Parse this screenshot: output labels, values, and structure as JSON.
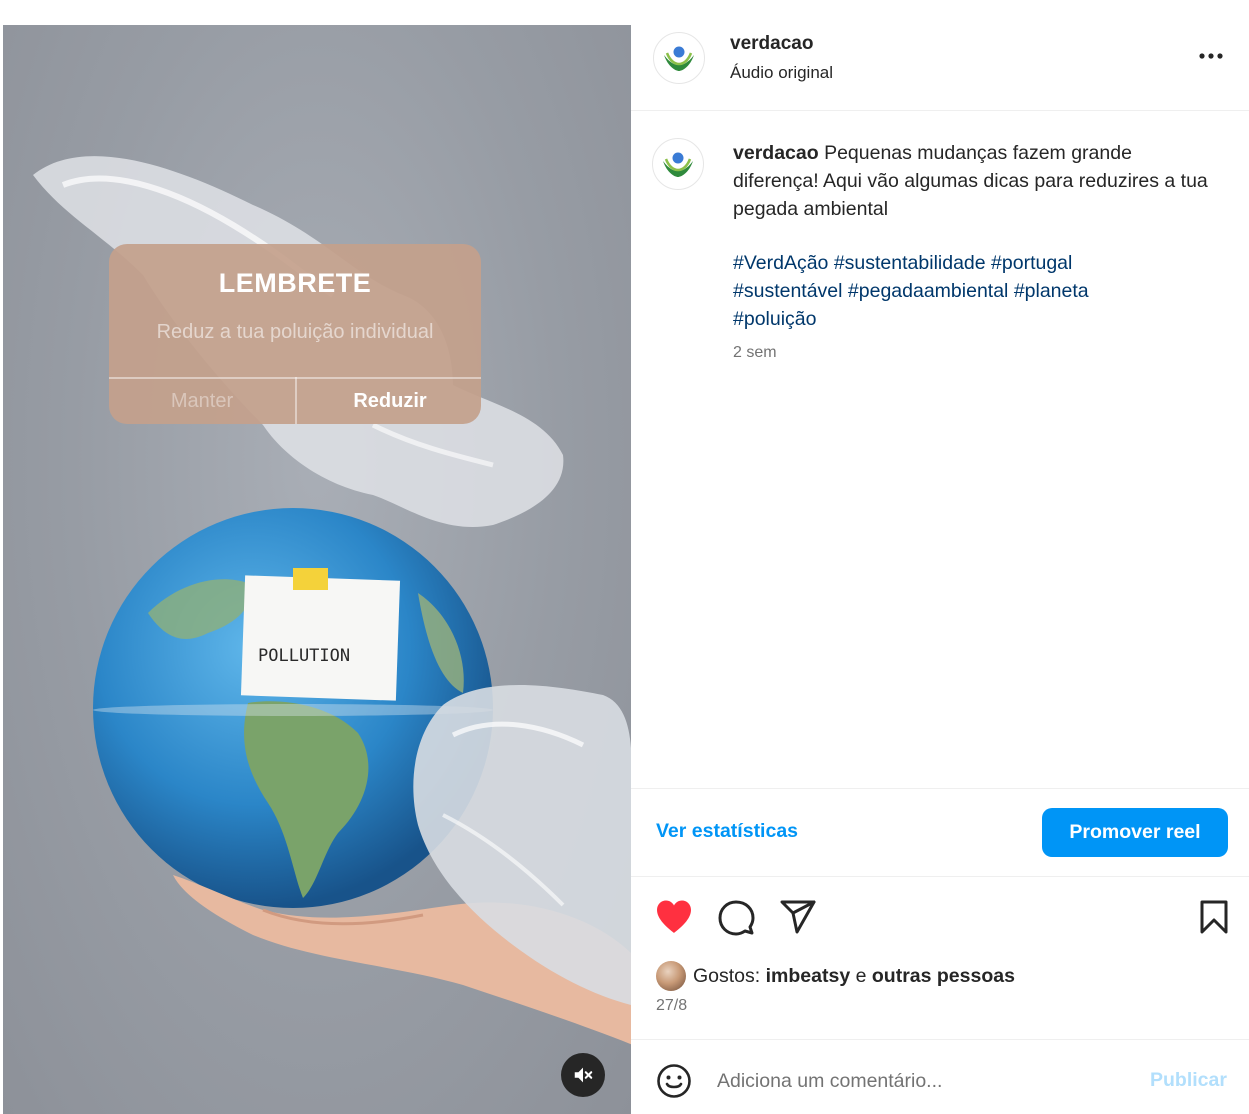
{
  "post": {
    "username": "verdacao",
    "audio": "Áudio original",
    "caption_text": "Pequenas mudanças fazem grande diferença! Aqui vão algumas dicas para reduzires a tua pegada ambiental",
    "hashtags": [
      "#VerdAção",
      "#sustentabilidade",
      "#portugal",
      "#sustentável",
      "#pegadaambiental",
      "#planeta",
      "#poluição"
    ],
    "time_ago": "2 sem"
  },
  "media": {
    "reminder_title": "LEMBRETE",
    "reminder_text": "Reduz a tua poluição individual",
    "keep_label": "Manter",
    "reduce_label": "Reduzir",
    "sticky_note": "POLLUTION",
    "mute_icon": "speaker-muted-icon"
  },
  "actions": {
    "stats_label": "Ver estatísticas",
    "promote_label": "Promover reel",
    "icons": [
      "heart-filled-icon",
      "comment-icon",
      "share-icon",
      "bookmark-icon"
    ],
    "liked": true
  },
  "likes": {
    "prefix": "Gostos:",
    "user": "imbeatsy",
    "connector": "e",
    "others": "outras pessoas"
  },
  "date": "27/8",
  "comment": {
    "placeholder": "Adiciona um comentário...",
    "value": "",
    "publish_label": "Publicar"
  },
  "colors": {
    "accent": "#0095f6",
    "like": "#ff3040",
    "hashtag": "#00376b",
    "muted_text": "#737373",
    "reminder_bg": "#c4a08c"
  }
}
